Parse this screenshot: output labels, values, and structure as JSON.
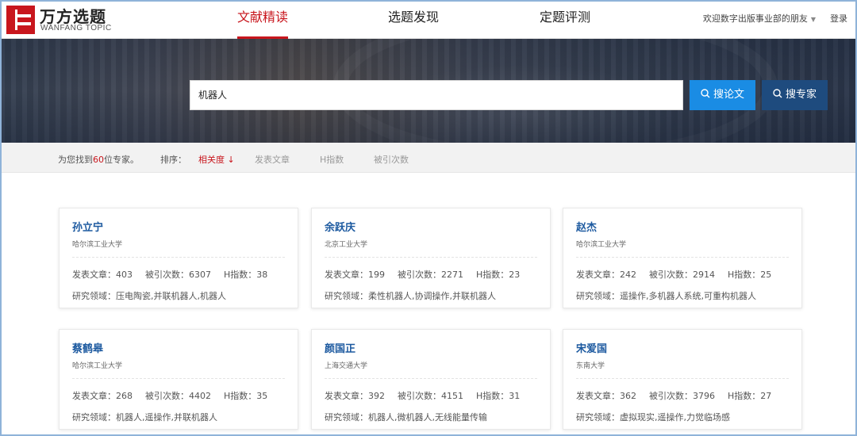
{
  "brand": {
    "name_cn": "万方选题",
    "name_en": "WANFANG TOPIC"
  },
  "nav": {
    "tabs": [
      {
        "label": "文献精读",
        "active": true
      },
      {
        "label": "选题发现",
        "active": false
      },
      {
        "label": "定题评测",
        "active": false
      }
    ]
  },
  "user": {
    "welcome": "欢迎数字出版事业部的朋友",
    "login": "登录"
  },
  "search": {
    "query": "机器人",
    "paper_button": "搜论文",
    "expert_button": "搜专家"
  },
  "results": {
    "found_prefix": "为您找到",
    "found_count": "60",
    "found_suffix": "位专家。",
    "sort_label": "排序：",
    "sort_active": "相关度",
    "sort_arrow": "↓",
    "sort_options": [
      "发表文章",
      "H指数",
      "被引次数"
    ]
  },
  "labels": {
    "papers": "发表文章：",
    "citations": "被引次数：",
    "h_index": "H指数：",
    "field": "研究领域："
  },
  "experts": [
    {
      "name": "孙立宁",
      "org": "哈尔滨工业大学",
      "papers": "403",
      "citations": "6307",
      "h_index": "38",
      "fields": "压电陶瓷,并联机器人,机器人"
    },
    {
      "name": "余跃庆",
      "org": "北京工业大学",
      "papers": "199",
      "citations": "2271",
      "h_index": "23",
      "fields": "柔性机器人,协调操作,并联机器人"
    },
    {
      "name": "赵杰",
      "org": "哈尔滨工业大学",
      "papers": "242",
      "citations": "2914",
      "h_index": "25",
      "fields": "遥操作,多机器人系统,可重构机器人"
    },
    {
      "name": "蔡鹤皋",
      "org": "哈尔滨工业大学",
      "papers": "268",
      "citations": "4402",
      "h_index": "35",
      "fields": "机器人,遥操作,并联机器人"
    },
    {
      "name": "颜国正",
      "org": "上海交通大学",
      "papers": "392",
      "citations": "4151",
      "h_index": "31",
      "fields": "机器人,微机器人,无线能量传输"
    },
    {
      "name": "宋爱国",
      "org": "东南大学",
      "papers": "362",
      "citations": "3796",
      "h_index": "27",
      "fields": "虚拟现实,遥操作,力觉临场感"
    }
  ],
  "colors": {
    "brand_red": "#c8161d",
    "link_blue": "#1d5aa0",
    "paper_button": "#1a8ce4",
    "expert_button": "#1e4b7e"
  }
}
